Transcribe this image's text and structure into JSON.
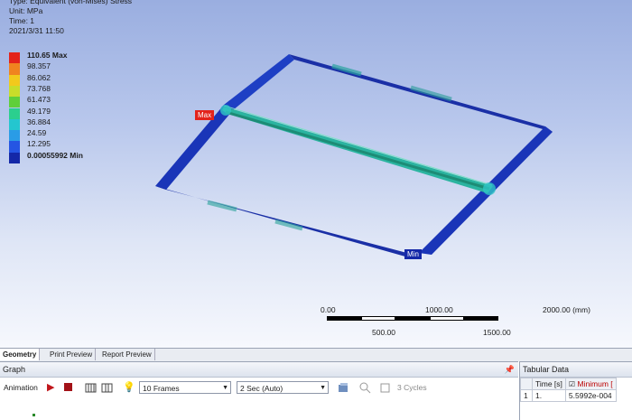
{
  "info": {
    "type": "Type: Equivalent (von-Mises) Stress",
    "unit": "Unit: MPa",
    "time": "Time: 1",
    "date": "2021/3/31 11:50"
  },
  "legend": [
    {
      "label": "110.65 Max",
      "color": "#e3231b",
      "bold": true
    },
    {
      "label": "98.357",
      "color": "#f0831f",
      "bold": false
    },
    {
      "label": "86.062",
      "color": "#f2c91c",
      "bold": false
    },
    {
      "label": "73.768",
      "color": "#c8dd2a",
      "bold": false
    },
    {
      "label": "61.473",
      "color": "#5fcf3a",
      "bold": false
    },
    {
      "label": "49.179",
      "color": "#2bcf8e",
      "bold": false
    },
    {
      "label": "36.884",
      "color": "#24c6cf",
      "bold": false
    },
    {
      "label": "24.59",
      "color": "#2a9ce6",
      "bold": false
    },
    {
      "label": "12.295",
      "color": "#2555e3",
      "bold": false
    },
    {
      "label": "0.00055992 Min",
      "color": "#1428a8",
      "bold": true
    }
  ],
  "probes": {
    "max": "Max",
    "min": "Min"
  },
  "scale": {
    "top": [
      "0.00",
      "1000.00",
      "2000.00 (mm)"
    ],
    "bottom": [
      "500.00",
      "1500.00"
    ]
  },
  "tabs": [
    "Geometry",
    "Print Preview",
    "Report Preview"
  ],
  "graph": {
    "title": "Graph",
    "animation_label": "Animation",
    "frames": "10 Frames",
    "speed": "2 Sec (Auto)",
    "cycles": "3 Cycles"
  },
  "tabular": {
    "title": "Tabular Data",
    "headers": [
      "",
      "Time [s]",
      "Minimum ["
    ],
    "rows": [
      [
        "1",
        "1.",
        "5.5992e-004"
      ]
    ]
  },
  "colors": {
    "frame": "#1a2fa6",
    "beam": "#2bb4a0",
    "max_tag": "#e3231b",
    "min_tag": "#1428a8"
  }
}
